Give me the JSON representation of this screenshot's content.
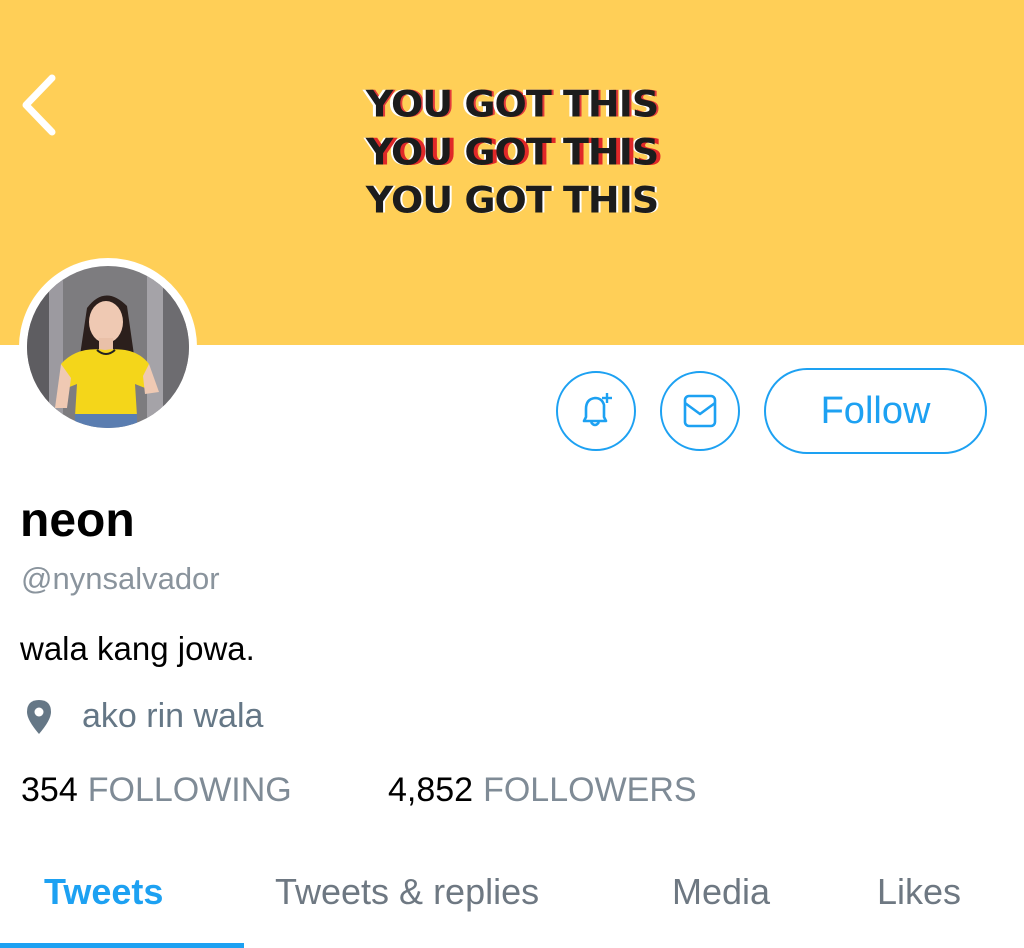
{
  "banner": {
    "lines": [
      "YOU GOT THIS",
      "YOU GOT THIS",
      "YOU GOT THIS"
    ],
    "background_color": "#ffcf57"
  },
  "nav": {
    "back_icon": "chevron-left-icon"
  },
  "profile": {
    "display_name": "neon",
    "handle": "@nynsalvador",
    "bio": "wala kang jowa.",
    "location": "ako rin wala",
    "location_icon": "map-pin-icon"
  },
  "actions": {
    "notify_icon": "bell-plus-icon",
    "message_icon": "envelope-icon",
    "follow_label": "Follow"
  },
  "stats": {
    "following_count": "354",
    "following_label": "FOLLOWING",
    "followers_count": "4,852",
    "followers_label": "FOLLOWERS"
  },
  "tabs": [
    {
      "label": "Tweets",
      "active": true
    },
    {
      "label": "Tweets & replies",
      "active": false
    },
    {
      "label": "Media",
      "active": false
    },
    {
      "label": "Likes",
      "active": false
    }
  ],
  "colors": {
    "accent": "#1da1f2",
    "secondary_text": "#657786"
  }
}
